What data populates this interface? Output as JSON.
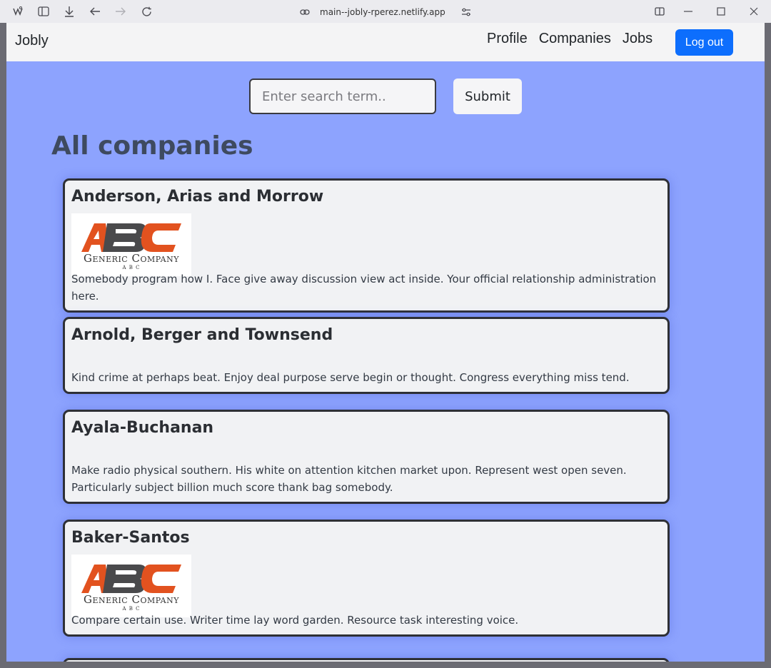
{
  "browser": {
    "url": "main--jobly-rperez.netlify.app"
  },
  "nav": {
    "brand": "Jobly",
    "links": [
      "Profile",
      "Companies",
      "Jobs"
    ],
    "logout_label": "Log out"
  },
  "search": {
    "placeholder": "Enter search term..",
    "submit_label": "Submit"
  },
  "page_title": "All companies",
  "logo_text": {
    "main": "Generic Company",
    "sub": "A B C"
  },
  "companies": [
    {
      "name": "Anderson, Arias and Morrow",
      "has_logo": true,
      "description": "Somebody program how I. Face give away discussion view act inside. Your official relationship administration here."
    },
    {
      "name": "Arnold, Berger and Townsend",
      "has_logo": false,
      "description": "Kind crime at perhaps beat. Enjoy deal purpose serve begin or thought. Congress everything miss tend."
    },
    {
      "name": "Ayala-Buchanan",
      "has_logo": false,
      "description": "Make radio physical southern. His white on attention kitchen market upon. Represent west open seven. Particularly subject billion much score thank bag somebody."
    },
    {
      "name": "Baker-Santos",
      "has_logo": true,
      "description": "Compare certain use. Writer time lay word garden. Resource task interesting voice."
    }
  ],
  "colors": {
    "page_bg": "#8da3fe",
    "primary": "#0d6efd",
    "logo_orange": "#e2521f",
    "logo_gray": "#4a4a4c"
  }
}
